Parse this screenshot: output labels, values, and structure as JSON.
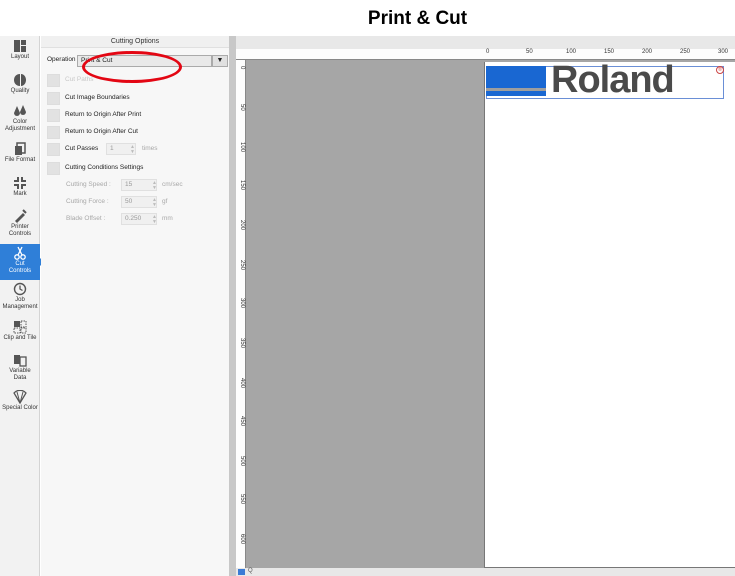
{
  "title": "Print & Cut",
  "rail": {
    "items": [
      {
        "label": "Layout",
        "icon": "layout-icon"
      },
      {
        "label": "Quality",
        "icon": "quality-icon"
      },
      {
        "label": "Color\nAdjustment",
        "icon": "color-adjustment-icon"
      },
      {
        "label": "File Format",
        "icon": "file-format-icon"
      },
      {
        "label": "Mark",
        "icon": "mark-icon"
      },
      {
        "label": "Printer\nControls",
        "icon": "printer-controls-icon"
      },
      {
        "label": "Cut\nControls",
        "icon": "scissors-icon",
        "active": true
      },
      {
        "label": "Job\nManagement",
        "icon": "clock-icon"
      },
      {
        "label": "Clip and Tile",
        "icon": "clip-tile-icon"
      },
      {
        "label": "Variable\nData",
        "icon": "variable-data-icon"
      },
      {
        "label": "Special Color",
        "icon": "special-color-icon"
      }
    ]
  },
  "panel": {
    "header": "Cutting Options",
    "mode_label": "Operation Mode :",
    "mode_value": "Print & Cut",
    "dropdown_arrow": "▼",
    "options": [
      {
        "label": "Cut Paths",
        "disabled": true
      },
      {
        "label": "Cut Image Boundaries",
        "disabled": false
      },
      {
        "label": "Return to Origin After Print",
        "disabled": false
      },
      {
        "label": "Return to Origin After Cut",
        "disabled": false
      },
      {
        "label": "Cut Passes",
        "disabled": false
      },
      {
        "label": "Cutting Conditions Settings",
        "disabled": false
      }
    ],
    "cut_passes_value": "1",
    "cut_passes_unit": "times",
    "conditions": [
      {
        "label": "Cutting Speed :",
        "value": "15",
        "unit": "cm/sec"
      },
      {
        "label": "Cutting Force :",
        "value": "50",
        "unit": "gf"
      },
      {
        "label": "Blade Offset :",
        "value": "0.250",
        "unit": "mm"
      }
    ]
  },
  "ruler": {
    "x_labels": [
      "0",
      "50",
      "100",
      "150",
      "200",
      "250",
      "300"
    ],
    "y_labels": [
      "0",
      "50",
      "100",
      "150",
      "200",
      "250",
      "300",
      "350",
      "400",
      "450",
      "500",
      "550",
      "600"
    ]
  },
  "logo": {
    "text": "Roland",
    "reg_mark": "®"
  },
  "status": {
    "zoom_label": "Q"
  },
  "colors": {
    "accent": "#2f7fd8",
    "highlight": "#e30613",
    "logo_blue": "#1967d2"
  }
}
